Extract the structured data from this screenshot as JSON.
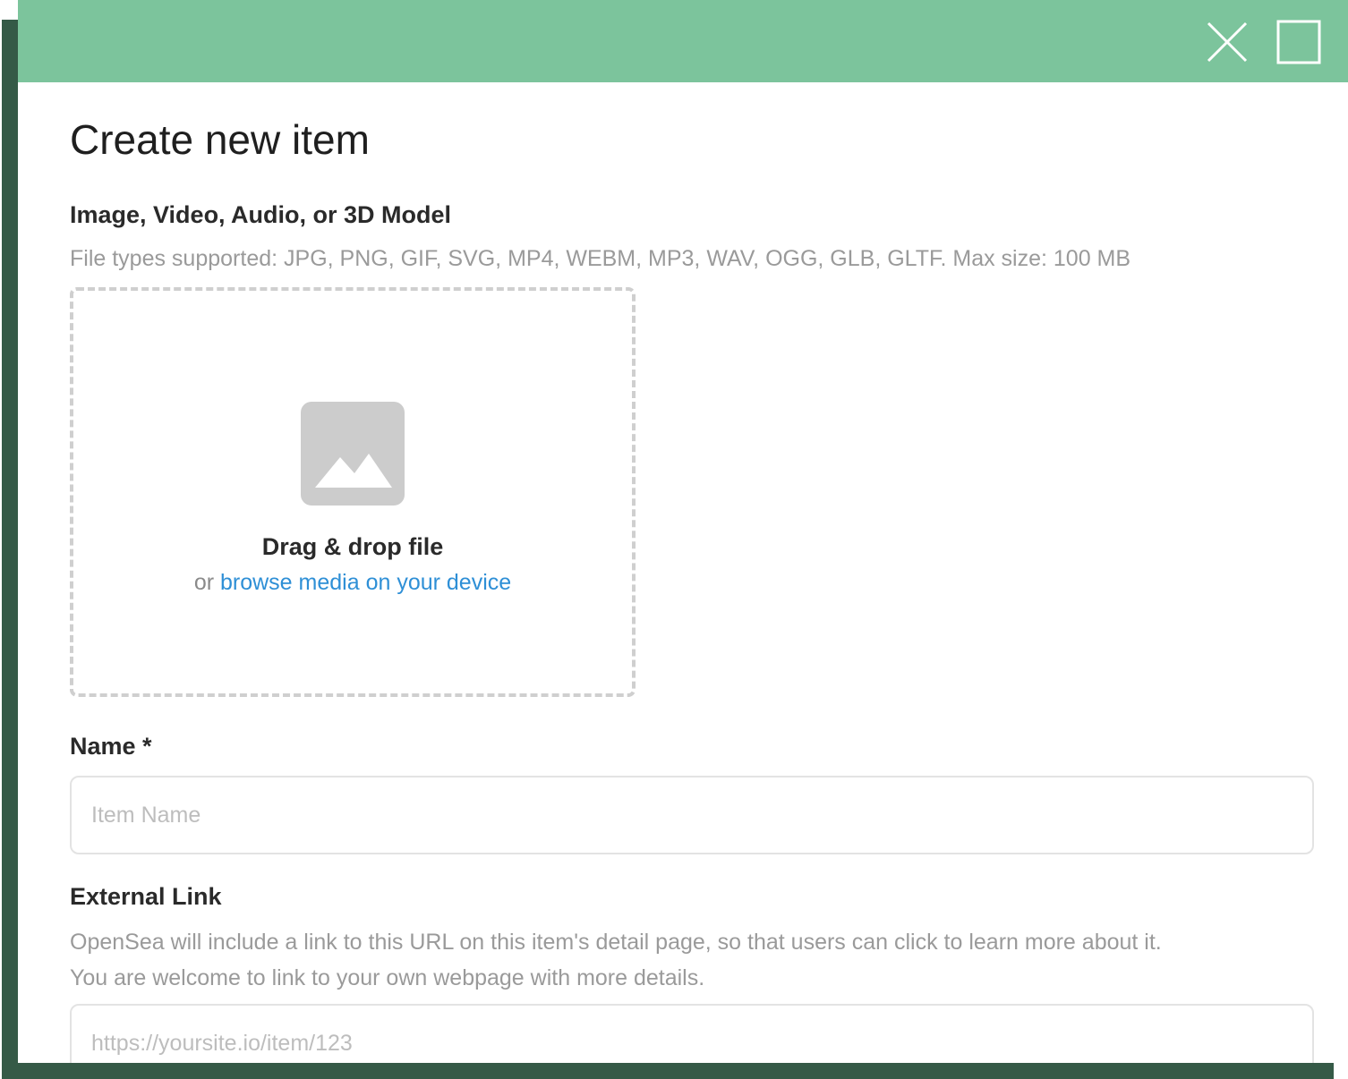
{
  "window": {
    "titlebar_color": "#7cc49c",
    "close_icon": "close-icon",
    "maximize_icon": "maximize-icon"
  },
  "page": {
    "title": "Create new item"
  },
  "media": {
    "label": "Image, Video, Audio, or 3D Model",
    "helper": "File types supported: JPG, PNG, GIF, SVG, MP4, WEBM, MP3, WAV, OGG, GLB, GLTF. Max size: 100 MB",
    "dropzone": {
      "icon": "image-placeholder-icon",
      "title": "Drag & drop file",
      "sub_prefix": "or",
      "browse_link": "browse media on your device"
    }
  },
  "name_field": {
    "label": "Name *",
    "placeholder": "Item Name",
    "value": ""
  },
  "external_link": {
    "label": "External Link",
    "helper_line1": "OpenSea will include a link to this URL on this item's detail page, so that users can click to learn more about it.",
    "helper_line2": "You are welcome to link to your own webpage with more details.",
    "placeholder": "https://yoursite.io/item/123",
    "value": ""
  },
  "colors": {
    "accent_link": "#2e8fd6",
    "frame_shadow": "#355a47"
  }
}
